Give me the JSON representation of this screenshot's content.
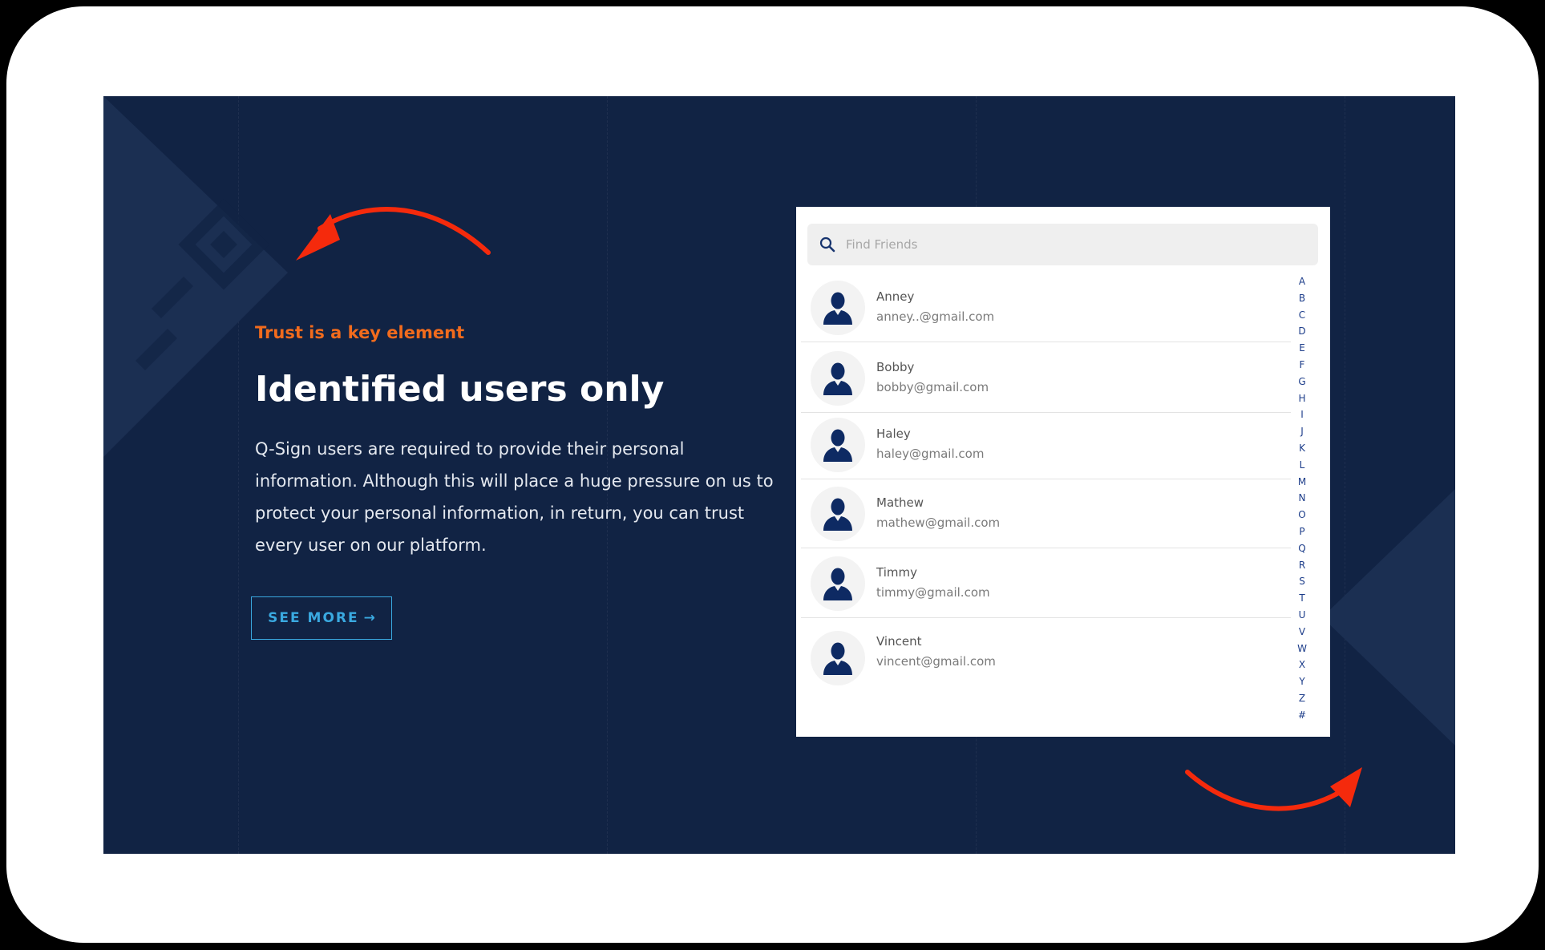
{
  "colors": {
    "background": "#112344",
    "accent_orange": "#f26b1d",
    "link_blue": "#3aa9e0",
    "arrow_red": "#f52a0c",
    "avatar_navy": "#0e2a63"
  },
  "hero": {
    "eyebrow": "Trust is a key element",
    "headline": "Identified users only",
    "body": "Q-Sign users are required to provide their personal information. Although this will place a huge pressure on us to protect your personal information, in return, you can trust every user on our platform.",
    "cta_label": "SEE MORE",
    "cta_icon": "arrow-right-icon"
  },
  "friends_panel": {
    "search": {
      "placeholder": "Find Friends",
      "value": "",
      "icon": "search-icon"
    },
    "contacts": [
      {
        "name": "Anney",
        "email": "anney..@gmail.com",
        "icon": "user-icon"
      },
      {
        "name": "Bobby",
        "email": "bobby@gmail.com",
        "icon": "user-icon"
      },
      {
        "name": "Haley",
        "email": "haley@gmail.com",
        "icon": "user-icon"
      },
      {
        "name": "Mathew",
        "email": "mathew@gmail.com",
        "icon": "user-icon"
      },
      {
        "name": "Timmy",
        "email": "timmy@gmail.com",
        "icon": "user-icon"
      },
      {
        "name": "Vincent",
        "email": "vincent@gmail.com",
        "icon": "user-icon"
      }
    ],
    "alphabet": [
      "A",
      "B",
      "C",
      "D",
      "E",
      "F",
      "G",
      "H",
      "I",
      "J",
      "K",
      "L",
      "M",
      "N",
      "O",
      "P",
      "Q",
      "R",
      "S",
      "T",
      "U",
      "V",
      "W",
      "X",
      "Y",
      "Z",
      "#"
    ]
  }
}
